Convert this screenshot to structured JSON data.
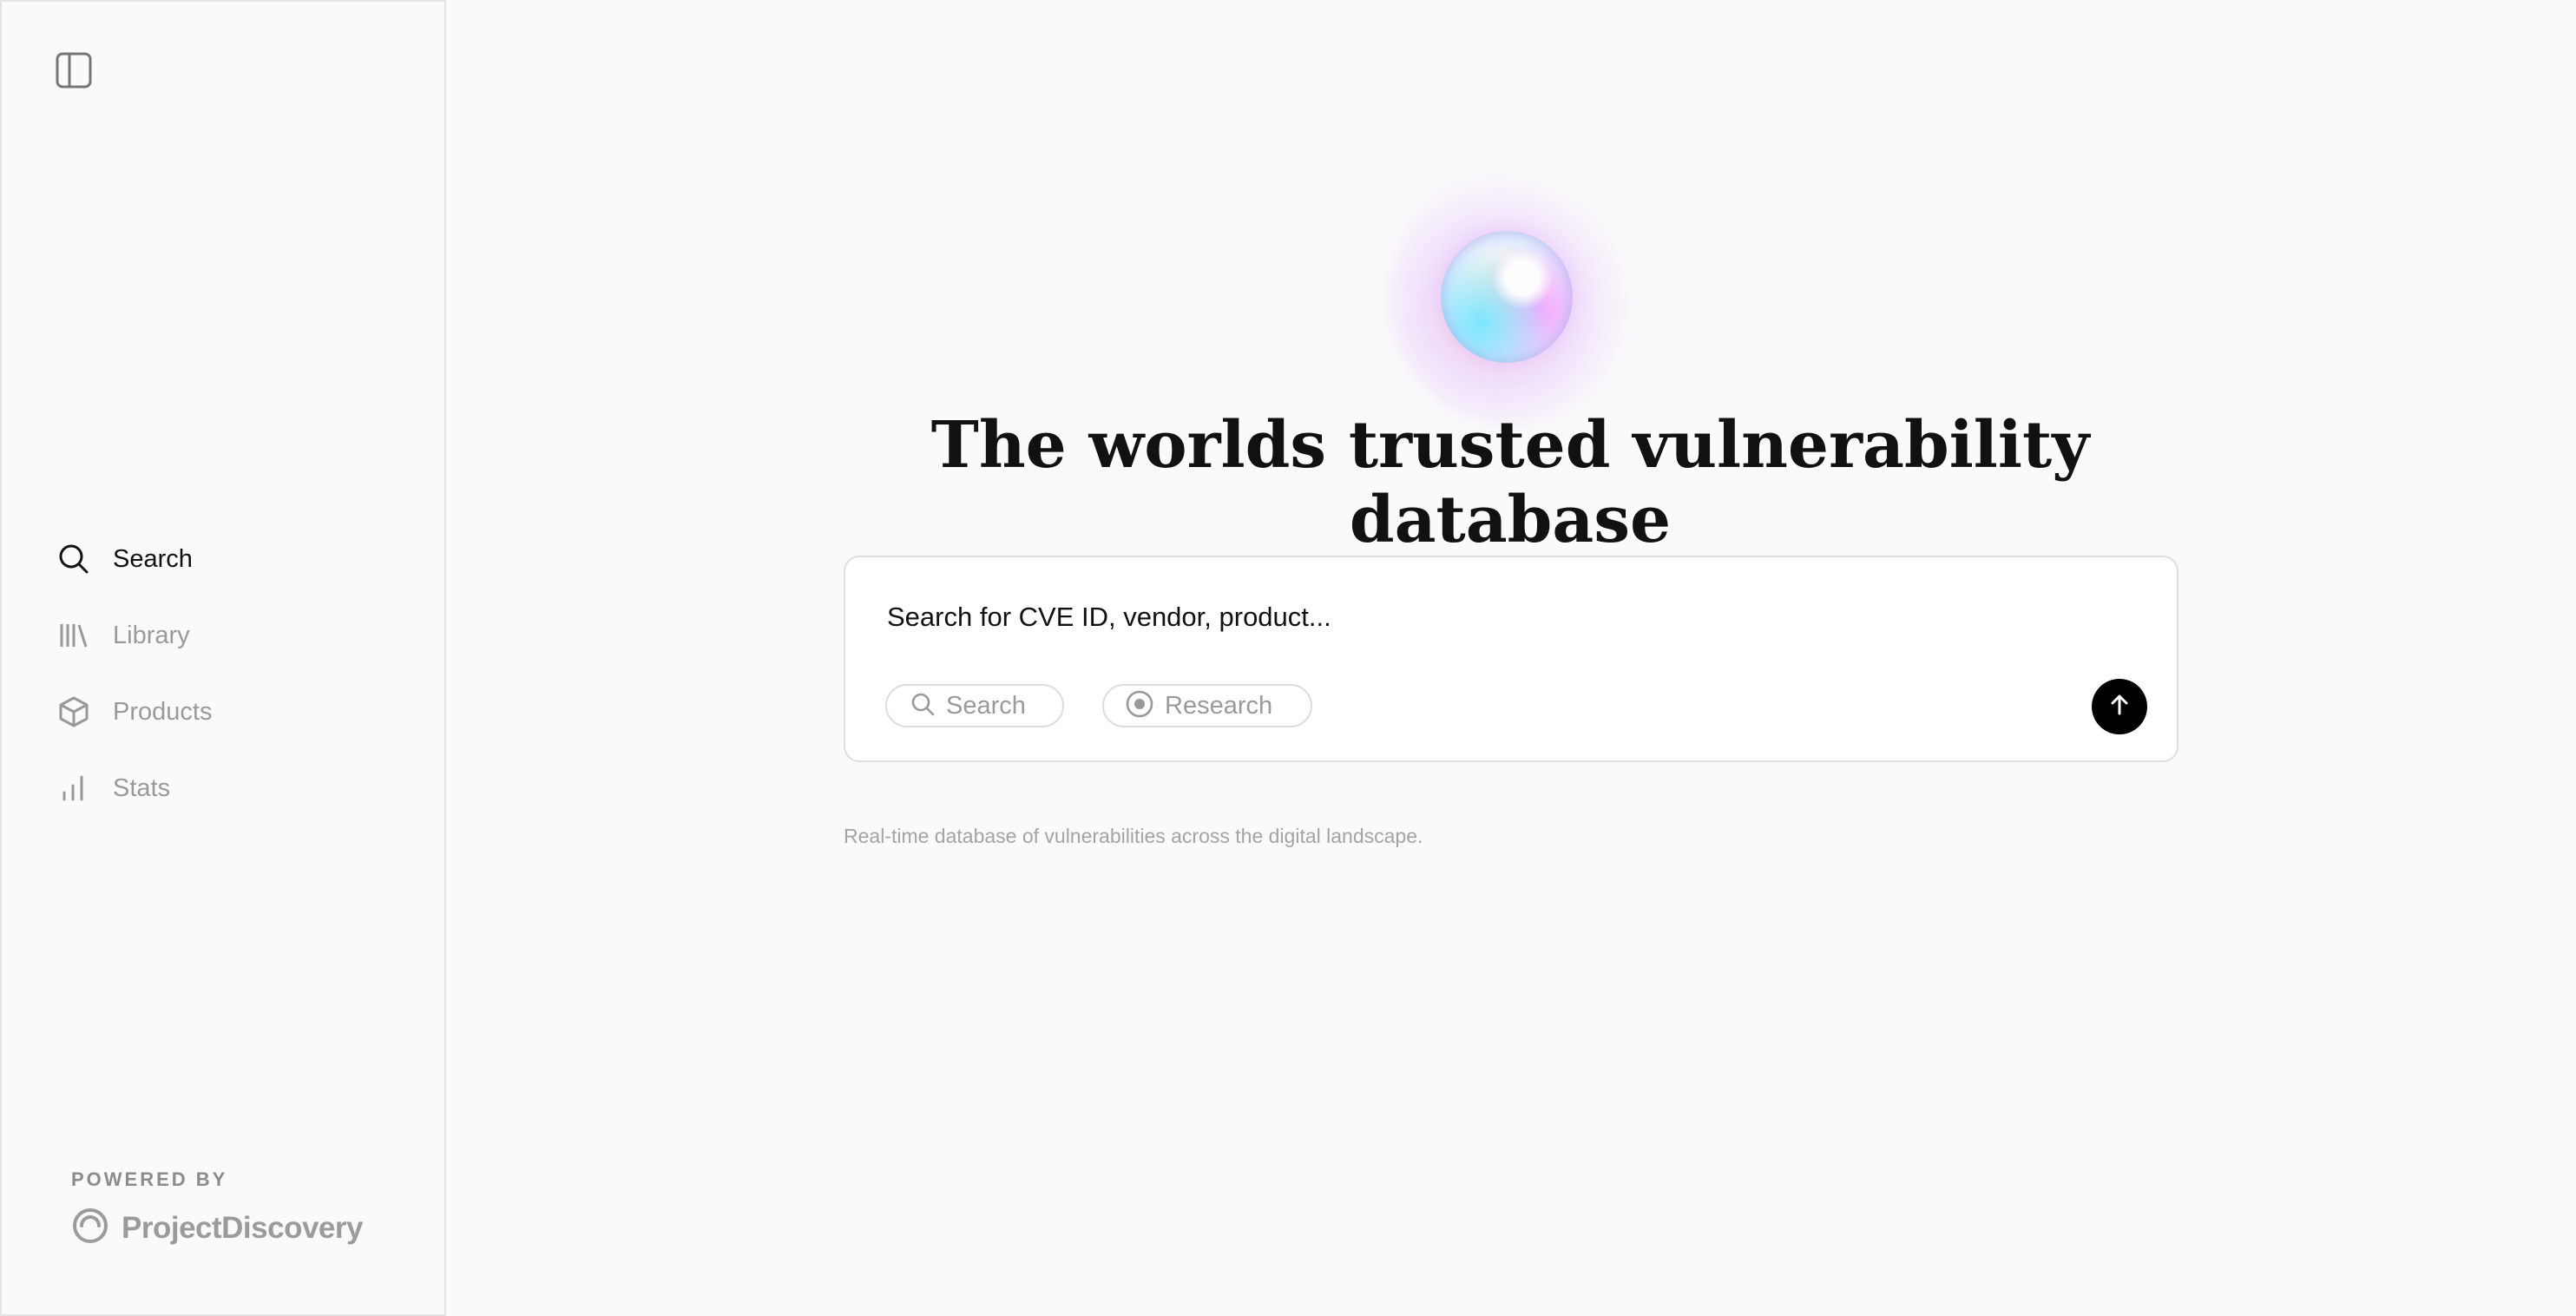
{
  "sidebar": {
    "nav": [
      {
        "label": "Search",
        "icon": "search-icon",
        "active": true
      },
      {
        "label": "Library",
        "icon": "library-icon",
        "active": false
      },
      {
        "label": "Products",
        "icon": "package-icon",
        "active": false
      },
      {
        "label": "Stats",
        "icon": "bar-chart-icon",
        "active": false
      }
    ],
    "powered_by": "POWERED BY",
    "brand": "ProjectDiscovery"
  },
  "main": {
    "headline": "The worlds trusted vulnerability database",
    "search": {
      "placeholder": "Search for CVE ID, vendor, product...",
      "mode_search": "Search",
      "mode_research": "Research"
    },
    "tagline": "Real-time database of vulnerabilities across the digital landscape."
  },
  "colors": {
    "background": "#fafafa",
    "text": "#111111",
    "muted": "#9a9a9a",
    "submit": "#000000"
  }
}
